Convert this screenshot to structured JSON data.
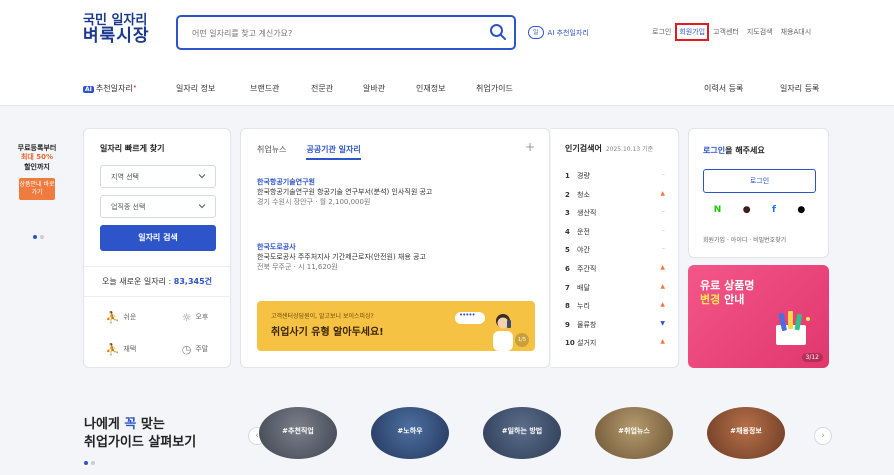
{
  "header": {
    "logo_line1": "국민 일자리",
    "logo_line2": "벼룩시장",
    "search_placeholder": "어떤 일자리를 찾고 계신가요?",
    "ai_pill": "일",
    "ai_label": "AI 추천일자리",
    "util": [
      "로그인",
      "회원가입",
      "고객센터",
      "지도검색",
      "채용A대시"
    ]
  },
  "gnb": {
    "ai_badge": "AI",
    "ai_label": "추천일자리",
    "items": [
      "일자리 정보",
      "브랜드관",
      "전문관",
      "알바관",
      "인재정보",
      "취업가이드"
    ],
    "right": [
      "이력서 등록",
      "일자리 등록"
    ]
  },
  "side_promo": {
    "line1": "무료등록부터",
    "line2": "최대 50%",
    "line3": "할인까지",
    "button": "상품안내 바로가기"
  },
  "quick": {
    "title": "일자리 빠르게 찾기",
    "region": "지역 선택",
    "job": "업직종 선택",
    "button": "일자리 검색",
    "today_prefix": "오늘 새로운 일자리 :",
    "today_count": "83,345건",
    "cells": [
      {
        "icon": "person-icon",
        "label": "쉬운"
      },
      {
        "icon": "sun-icon",
        "label": "오후"
      },
      {
        "icon": "person-icon",
        "label": "재택"
      },
      {
        "icon": "clock-icon",
        "label": "주말"
      }
    ]
  },
  "news": {
    "tabs": [
      "취업뉴스",
      "공공기관 일자리"
    ],
    "plus": "+",
    "items": [
      {
        "org": "한국항공기술연구원",
        "title": "한국항공기술연구원 항공기술 연구부서(분석) 인사직원 공고",
        "meta": "경기 수원시 장안구 · 월 2,100,000원"
      },
      {
        "org": "한국도로공사",
        "title": "한국도로공사 주주처지사 기간제근로자(안전원) 채용 공고",
        "meta": "전북 무주군 · 시 11,620원"
      }
    ],
    "banner_small": "고객센터상담원이, 알고보니 보이스피싱?",
    "banner_big": "취업사기 유형 알아두세요!",
    "banner_page": "1/5"
  },
  "popular": {
    "title": "인기검색어",
    "date": "2025.10.13 기준",
    "ranks": [
      {
        "no": "1",
        "word": "경량",
        "trend": "–"
      },
      {
        "no": "2",
        "word": "청소",
        "trend": "▲"
      },
      {
        "no": "3",
        "word": "생산직",
        "trend": "–"
      },
      {
        "no": "4",
        "word": "운전",
        "trend": "–"
      },
      {
        "no": "5",
        "word": "야간",
        "trend": "–"
      },
      {
        "no": "6",
        "word": "주간직",
        "trend": "▲"
      },
      {
        "no": "7",
        "word": "배달",
        "trend": "▲"
      },
      {
        "no": "8",
        "word": "누리",
        "trend": "▲"
      },
      {
        "no": "9",
        "word": "물류창",
        "trend": "▼"
      },
      {
        "no": "10",
        "word": "설거지",
        "trend": "▲"
      }
    ]
  },
  "login": {
    "title_prefix": "로그인",
    "title_suffix": "을 해주세요",
    "button": "로그인",
    "sns": [
      "N",
      "●",
      "f",
      "●"
    ],
    "links": "회원가입 · 아이디 · 비밀번호찾기"
  },
  "pink_banner": {
    "line1": "유료 상품명",
    "line2_hl": "변경",
    "line2_rest": " 안내",
    "page": "3/12"
  },
  "guide": {
    "title_prefix": "나에게 ",
    "title_hl": "꼭",
    "title_suffix": " 맞는",
    "title_line2": "취업가이드 살펴보기",
    "thumbs": [
      "#추천직업",
      "#노하우",
      "#일하는 방법",
      "#취업뉴스",
      "#채용정보"
    ],
    "prev": "‹",
    "next": "›"
  },
  "colors": {
    "primary": "#2d54c9",
    "accent_orange": "#f07b3f",
    "highlight_red": "#e01d24",
    "pink": "#e0376d",
    "yellow": "#f6c244"
  }
}
